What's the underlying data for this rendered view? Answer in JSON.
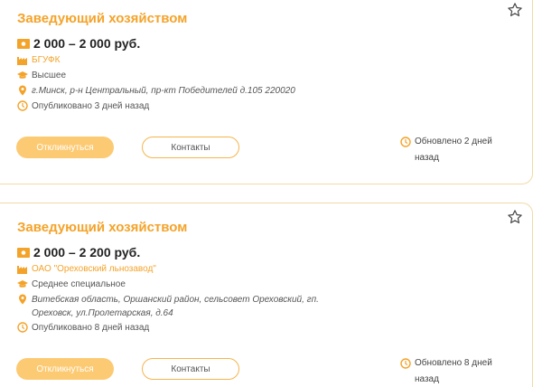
{
  "vacancies": [
    {
      "title": "Заведующий хозяйством",
      "salary": "2 000 – 2 000 руб.",
      "employer": "БГУФК",
      "education": "Высшее",
      "address": "г.Минск, р-н Центральный, пр-кт Победителей д.105 220020",
      "published": "Опубликовано 3 дней назад",
      "respond_label": "Откликнуться",
      "contacts_label": "Контакты",
      "updated": "Обновлено 2 дней назад"
    },
    {
      "title": "Заведующий хозяйством",
      "salary": "2 000 – 2 200 руб.",
      "employer": "ОАО \"Ореховский льнозавод\"",
      "education": "Среднее специальное",
      "address": "Витебская область, Оршанский район, сельсовет Ореховский, гп. Ореховск, ул.Пролетарская, д.64",
      "published": "Опубликовано 8 дней назад",
      "respond_label": "Откликнуться",
      "contacts_label": "Контакты",
      "updated": "Обновлено 8 дней назад"
    }
  ],
  "colors": {
    "accent": "#f4a32a",
    "button_fill": "#fcca73",
    "border": "#f3d9a6"
  },
  "icons": [
    "money-icon",
    "factory-icon",
    "graduation-cap-icon",
    "location-pin-icon",
    "clock-icon",
    "star-icon"
  ]
}
